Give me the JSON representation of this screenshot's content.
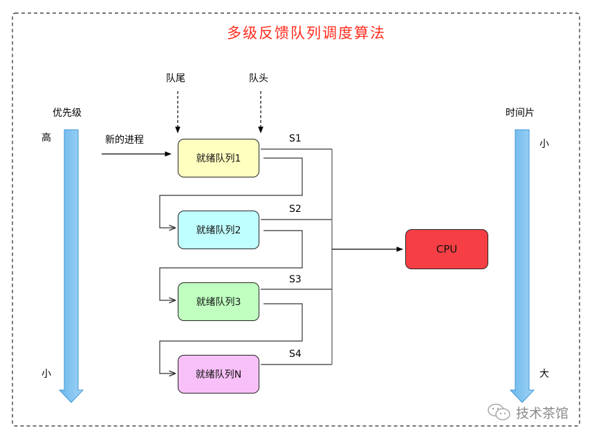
{
  "title": "多级反馈队列调度算法",
  "colors": {
    "title": "#ff2b1c",
    "arrow_fill_start": "#6cb8ec",
    "arrow_fill_end": "#9fd3f5",
    "arrow_stroke": "#3d96d8",
    "cpu": "#f53f45"
  },
  "priority": {
    "label": "优先级",
    "high": "高",
    "low": "小"
  },
  "time_slice": {
    "label": "时间片",
    "small": "小",
    "large": "大"
  },
  "pointers": {
    "tail": "队尾",
    "head": "队头"
  },
  "new_process_label": "新的进程",
  "queues": [
    {
      "label": "就绪队列1",
      "slice": "S1",
      "color": "#ffffc0"
    },
    {
      "label": "就绪队列2",
      "slice": "S2",
      "color": "#c0ffff"
    },
    {
      "label": "就绪队列3",
      "slice": "S3",
      "color": "#c0ffc0"
    },
    {
      "label": "就绪队列N",
      "slice": "S4",
      "color": "#f8c0f8"
    }
  ],
  "cpu_label": "CPU",
  "watermark": {
    "icon": "wechat-icon",
    "text": "技术茶馆"
  }
}
